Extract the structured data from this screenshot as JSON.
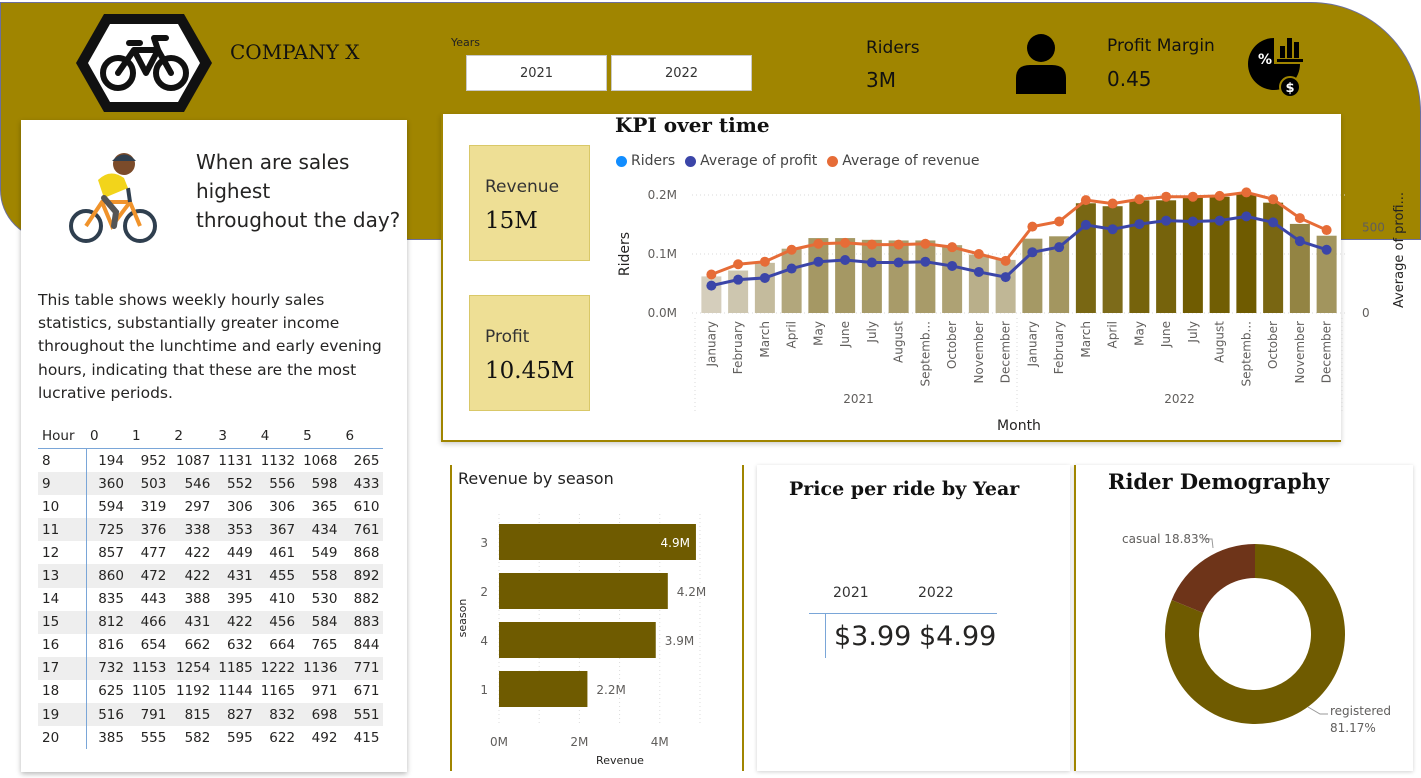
{
  "header": {
    "company": "COMPANY X",
    "years_label": "Years",
    "years": [
      "2021",
      "2022"
    ],
    "riders_label": "Riders",
    "riders_value": "3M",
    "profit_margin_label": "Profit Margin",
    "profit_margin_value": "0.45",
    "accent_color": "#a08500"
  },
  "left_panel": {
    "question": [
      "When are sales",
      "highest",
      "throughout the day?"
    ],
    "description": "This table shows weekly hourly sales statistics, substantially greater income throughout the lunchtime and early evening hours, indicating that these are the most lucrative periods.",
    "table": {
      "headers": [
        "Hour",
        "0",
        "1",
        "2",
        "3",
        "4",
        "5",
        "6"
      ],
      "rows": [
        [
          "8",
          "194",
          "952",
          "1087",
          "1131",
          "1132",
          "1068",
          "265"
        ],
        [
          "9",
          "360",
          "503",
          "546",
          "552",
          "556",
          "598",
          "433"
        ],
        [
          "10",
          "594",
          "319",
          "297",
          "306",
          "306",
          "365",
          "610"
        ],
        [
          "11",
          "725",
          "376",
          "338",
          "353",
          "367",
          "434",
          "761"
        ],
        [
          "12",
          "857",
          "477",
          "422",
          "449",
          "461",
          "549",
          "868"
        ],
        [
          "13",
          "860",
          "472",
          "422",
          "431",
          "455",
          "558",
          "892"
        ],
        [
          "14",
          "835",
          "443",
          "388",
          "395",
          "410",
          "530",
          "882"
        ],
        [
          "15",
          "812",
          "466",
          "431",
          "422",
          "456",
          "584",
          "883"
        ],
        [
          "16",
          "816",
          "654",
          "662",
          "632",
          "664",
          "765",
          "844"
        ],
        [
          "17",
          "732",
          "1153",
          "1254",
          "1185",
          "1222",
          "1136",
          "771"
        ],
        [
          "18",
          "625",
          "1105",
          "1192",
          "1144",
          "1165",
          "971",
          "671"
        ],
        [
          "19",
          "516",
          "791",
          "815",
          "827",
          "832",
          "698",
          "551"
        ],
        [
          "20",
          "385",
          "555",
          "582",
          "595",
          "622",
          "492",
          "415"
        ]
      ]
    }
  },
  "tiles": {
    "revenue_label": "Revenue",
    "revenue_value": "15M",
    "profit_label": "Profit",
    "profit_value": "10.45M"
  },
  "chart_data": [
    {
      "type": "bar",
      "title": "KPI over time",
      "subtype": "combo bar + line, dual axis",
      "legend": [
        "Riders",
        "Average of profit",
        "Average of revenue"
      ],
      "legend_colors": [
        "#118dff",
        "#3b45a8",
        "#e66c37"
      ],
      "xlabel": "Month",
      "ylabel_left": "Riders",
      "ylabel_right": "Average of profi...",
      "years": [
        "2021",
        "2022"
      ],
      "months_2021": [
        "January",
        "February",
        "March",
        "April",
        "May",
        "June",
        "July",
        "August",
        "Septemb...",
        "October",
        "November",
        "December"
      ],
      "months_2022": [
        "January",
        "February",
        "March",
        "April",
        "May",
        "June",
        "July",
        "August",
        "Septemb...",
        "October",
        "November",
        "December"
      ],
      "left_ticks": [
        "0.0M",
        "0.1M",
        "0.2M"
      ],
      "right_ticks": [
        "0",
        "500"
      ],
      "ylim_left": [
        0,
        0.2
      ],
      "ylim_right": [
        0,
        690
      ],
      "riders": [
        0.062,
        0.072,
        0.085,
        0.109,
        0.127,
        0.127,
        0.124,
        0.123,
        0.123,
        0.115,
        0.099,
        0.09,
        0.126,
        0.13,
        0.186,
        0.181,
        0.191,
        0.191,
        0.199,
        0.197,
        0.201,
        0.187,
        0.151,
        0.131
      ],
      "avg_profit": [
        160,
        195,
        205,
        260,
        300,
        310,
        295,
        295,
        300,
        275,
        240,
        210,
        355,
        385,
        515,
        490,
        520,
        540,
        535,
        540,
        565,
        530,
        420,
        370
      ],
      "avg_revenue": [
        225,
        285,
        300,
        370,
        405,
        410,
        400,
        400,
        405,
        385,
        345,
        305,
        505,
        535,
        660,
        640,
        665,
        680,
        680,
        685,
        705,
        665,
        555,
        485
      ]
    },
    {
      "type": "bar",
      "title": "Revenue by season",
      "orientation": "horizontal",
      "ylabel": "season",
      "xlabel": "Revenue",
      "categories": [
        "3",
        "2",
        "4",
        "1"
      ],
      "values": [
        4.9,
        4.2,
        3.9,
        2.2
      ],
      "labels": [
        "4.9M",
        "4.2M",
        "3.9M",
        "2.2M"
      ],
      "x_ticks": [
        "0M",
        "2M",
        "4M"
      ],
      "xlim": [
        0,
        5.2
      ],
      "color": "#6f5b00"
    },
    {
      "type": "table",
      "title": "Price per ride by Year",
      "columns": [
        "2021",
        "2022"
      ],
      "values": [
        "$3.99",
        "$4.99"
      ]
    },
    {
      "type": "pie",
      "title": "Rider Demography",
      "donut": true,
      "slices": [
        {
          "name": "registered",
          "value": 81.17,
          "label": "81.17%",
          "color": "#6f5b00"
        },
        {
          "name": "casual",
          "value": 18.83,
          "label": "18.83%",
          "color": "#6e3419"
        }
      ]
    }
  ]
}
